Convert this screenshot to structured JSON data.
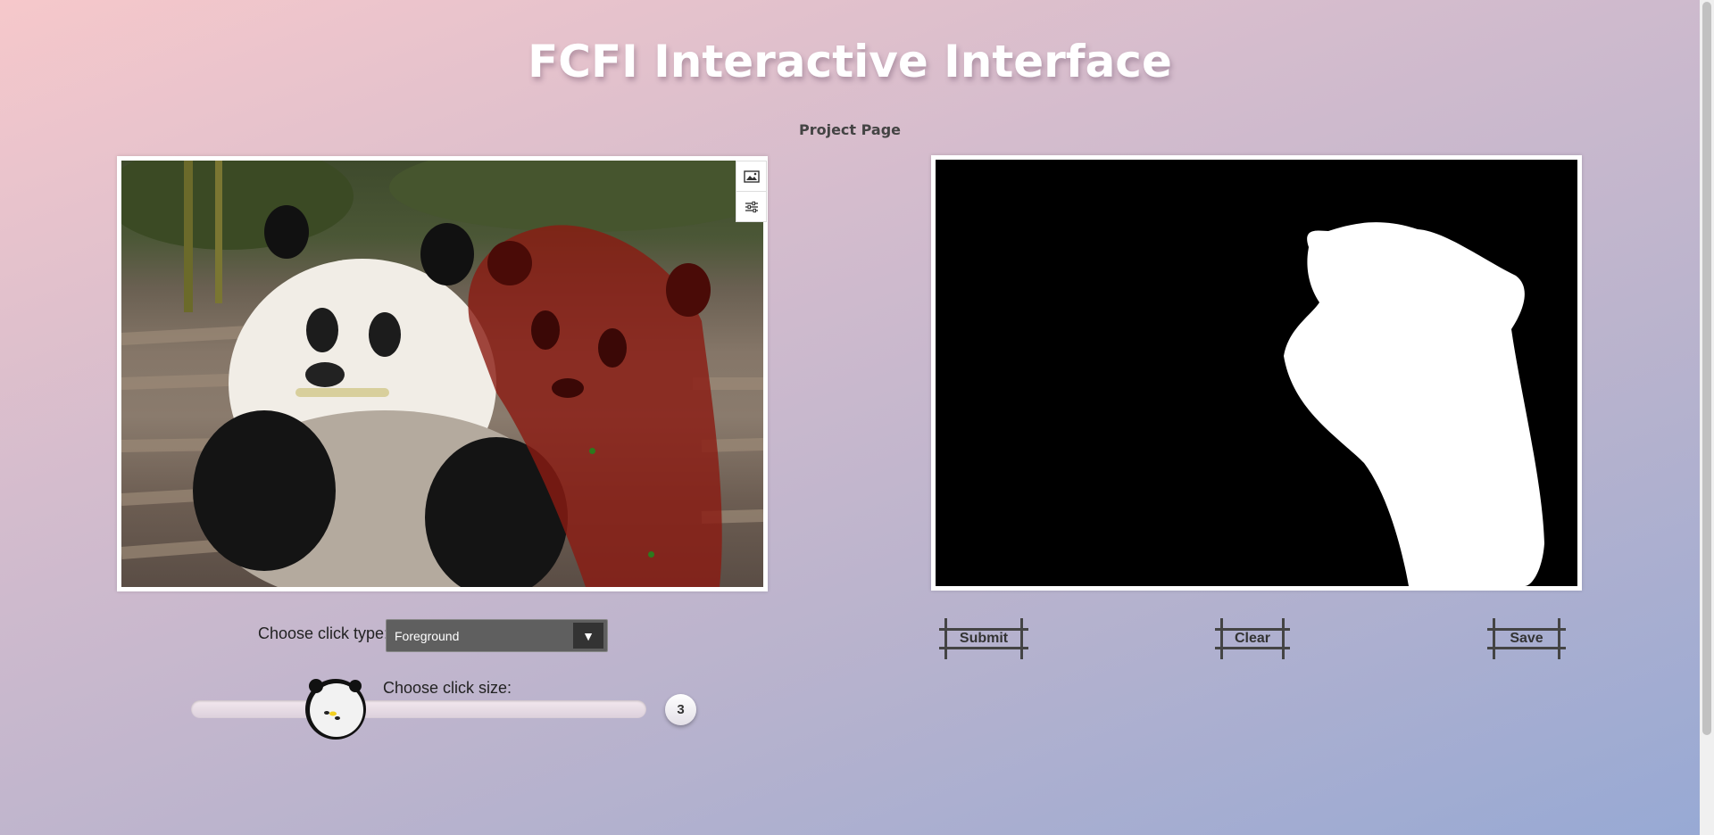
{
  "page": {
    "title": "FCFI Interactive Interface",
    "project_link": "Project Page"
  },
  "image_panel": {
    "tools": [
      {
        "icon": "image-icon"
      },
      {
        "icon": "sliders-icon"
      }
    ],
    "overlay_color": "#8b1a12",
    "click_point_color": "#2d7a1e"
  },
  "controls": {
    "click_type_label": "Choose click type:",
    "click_type_value": "Foreground",
    "click_size_label": "Choose click size:",
    "click_size_value": "3"
  },
  "actions": {
    "submit_label": "Submit",
    "clear_label": "Clear",
    "save_label": "Save"
  }
}
